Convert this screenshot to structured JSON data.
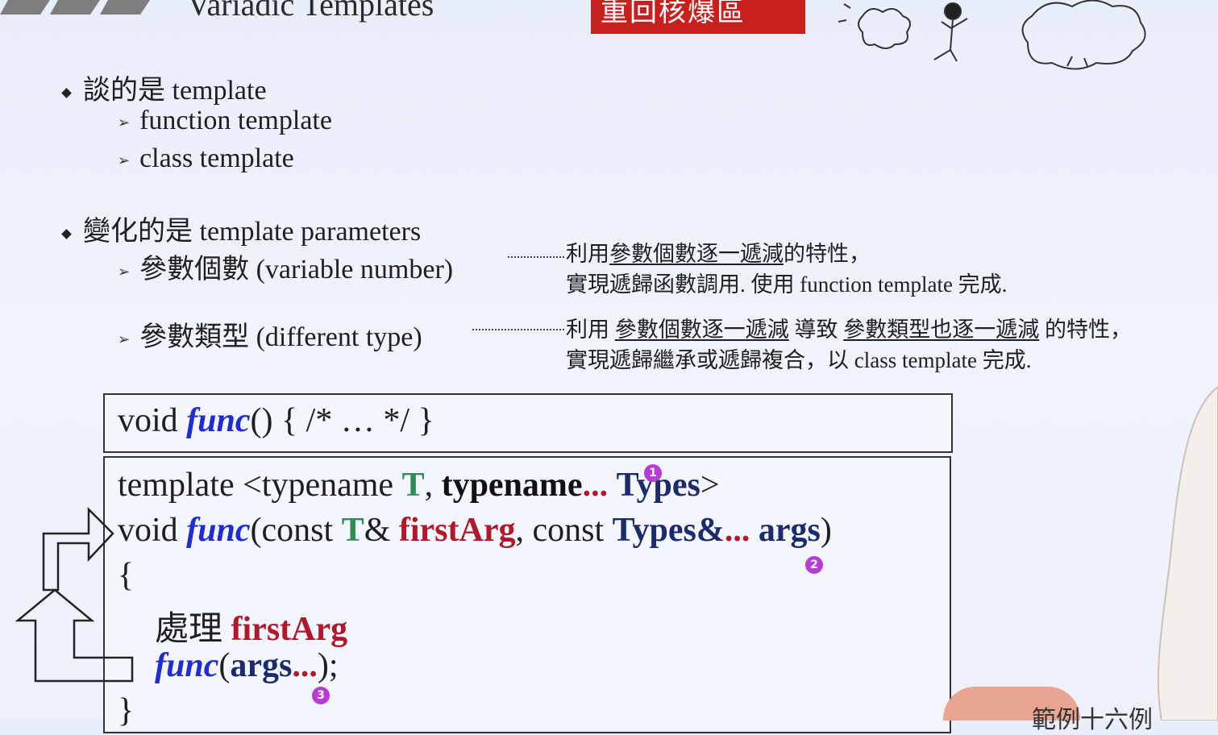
{
  "slide": {
    "title": "Variadic Templates",
    "banner": "重回核爆區",
    "bullets": [
      {
        "label": "談的是 template",
        "subs": [
          "function template",
          "class template"
        ]
      },
      {
        "label": "變化的是 template parameters",
        "subs": [
          "參數個數 (variable number)",
          "參數類型 (different type)"
        ]
      }
    ],
    "notes": {
      "variable_number": {
        "line1_pre": "利用",
        "line1_ul": "參數個數逐一遞減",
        "line1_post": "的特性，",
        "line2": "實現遞歸函數調用. 使用 function template 完成."
      },
      "different_type": {
        "line1_pre": "利用 ",
        "line1_ul1": "參數個數逐一遞減",
        "line1_mid": " 導致 ",
        "line1_ul2": "參數類型也逐一遞減",
        "line1_post": " 的特性，",
        "line2": "實現遞歸繼承或遞歸複合，以 class template 完成."
      }
    },
    "code_box1": {
      "void": "void ",
      "func": "func",
      "rest": "() {  /* … */ }"
    },
    "code_box2": {
      "line1": {
        "a": "template <typename ",
        "T": "T",
        "b": ", ",
        "typename": "typename",
        "ell": "...",
        "sp": " ",
        "types": "Types",
        "c": ">"
      },
      "line2": {
        "void": "void ",
        "func": "func",
        "a": "(const ",
        "T": "T",
        "b": "& ",
        "first": "firstArg",
        "c": ", const ",
        "types": "Types&",
        "ell": "...",
        "sp": " ",
        "args": "args",
        "d": ")"
      },
      "line3": "{",
      "line4": {
        "a": "處理 ",
        "first": "firstArg"
      },
      "line5": {
        "func": "func",
        "a": "(",
        "args": "args",
        "ell": "...",
        "b": ");"
      },
      "line6": "}"
    },
    "markers": [
      "1",
      "2",
      "3"
    ],
    "corner_text": "範例十六例"
  },
  "colors": {
    "banner": "#c8201e",
    "func": "#1f2bd6",
    "T": "#2e8b57",
    "red": "#b3182a",
    "types": "#1c2b6e",
    "marker": "#b93ad6"
  }
}
